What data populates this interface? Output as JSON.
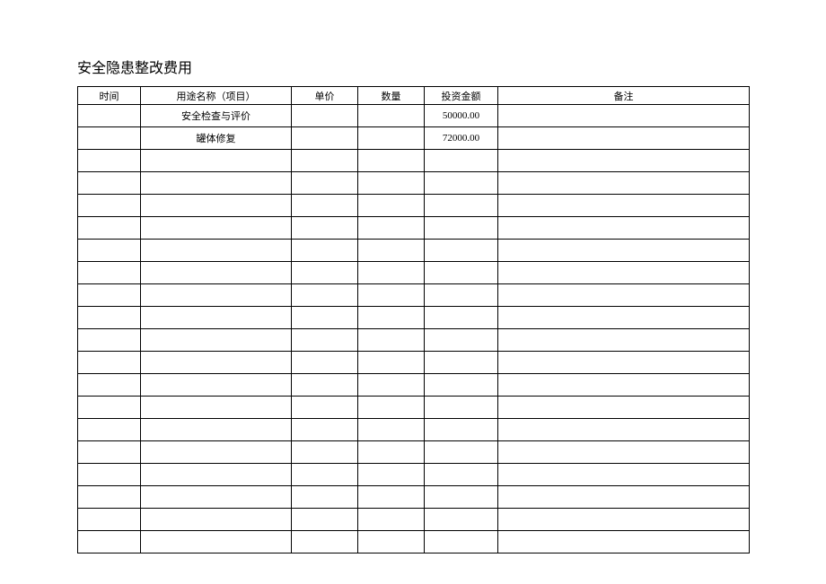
{
  "title": "安全隐患整改费用",
  "table": {
    "headers": {
      "time": "时间",
      "name": "用途名称（项目）",
      "price": "单价",
      "qty": "数量",
      "amount": "投资金额",
      "remark": "备注"
    },
    "rows": [
      {
        "time": "",
        "name": "安全检查与评价",
        "price": "",
        "qty": "",
        "amount": "50000.00",
        "remark": ""
      },
      {
        "time": "",
        "name": "罐体修复",
        "price": "",
        "qty": "",
        "amount": "72000.00",
        "remark": ""
      },
      {
        "time": "",
        "name": "",
        "price": "",
        "qty": "",
        "amount": "",
        "remark": ""
      },
      {
        "time": "",
        "name": "",
        "price": "",
        "qty": "",
        "amount": "",
        "remark": ""
      },
      {
        "time": "",
        "name": "",
        "price": "",
        "qty": "",
        "amount": "",
        "remark": ""
      },
      {
        "time": "",
        "name": "",
        "price": "",
        "qty": "",
        "amount": "",
        "remark": ""
      },
      {
        "time": "",
        "name": "",
        "price": "",
        "qty": "",
        "amount": "",
        "remark": ""
      },
      {
        "time": "",
        "name": "",
        "price": "",
        "qty": "",
        "amount": "",
        "remark": ""
      },
      {
        "time": "",
        "name": "",
        "price": "",
        "qty": "",
        "amount": "",
        "remark": ""
      },
      {
        "time": "",
        "name": "",
        "price": "",
        "qty": "",
        "amount": "",
        "remark": ""
      },
      {
        "time": "",
        "name": "",
        "price": "",
        "qty": "",
        "amount": "",
        "remark": ""
      },
      {
        "time": "",
        "name": "",
        "price": "",
        "qty": "",
        "amount": "",
        "remark": ""
      },
      {
        "time": "",
        "name": "",
        "price": "",
        "qty": "",
        "amount": "",
        "remark": ""
      },
      {
        "time": "",
        "name": "",
        "price": "",
        "qty": "",
        "amount": "",
        "remark": ""
      },
      {
        "time": "",
        "name": "",
        "price": "",
        "qty": "",
        "amount": "",
        "remark": ""
      },
      {
        "time": "",
        "name": "",
        "price": "",
        "qty": "",
        "amount": "",
        "remark": ""
      },
      {
        "time": "",
        "name": "",
        "price": "",
        "qty": "",
        "amount": "",
        "remark": ""
      },
      {
        "time": "",
        "name": "",
        "price": "",
        "qty": "",
        "amount": "",
        "remark": ""
      },
      {
        "time": "",
        "name": "",
        "price": "",
        "qty": "",
        "amount": "",
        "remark": ""
      },
      {
        "time": "",
        "name": "",
        "price": "",
        "qty": "",
        "amount": "",
        "remark": ""
      }
    ]
  }
}
